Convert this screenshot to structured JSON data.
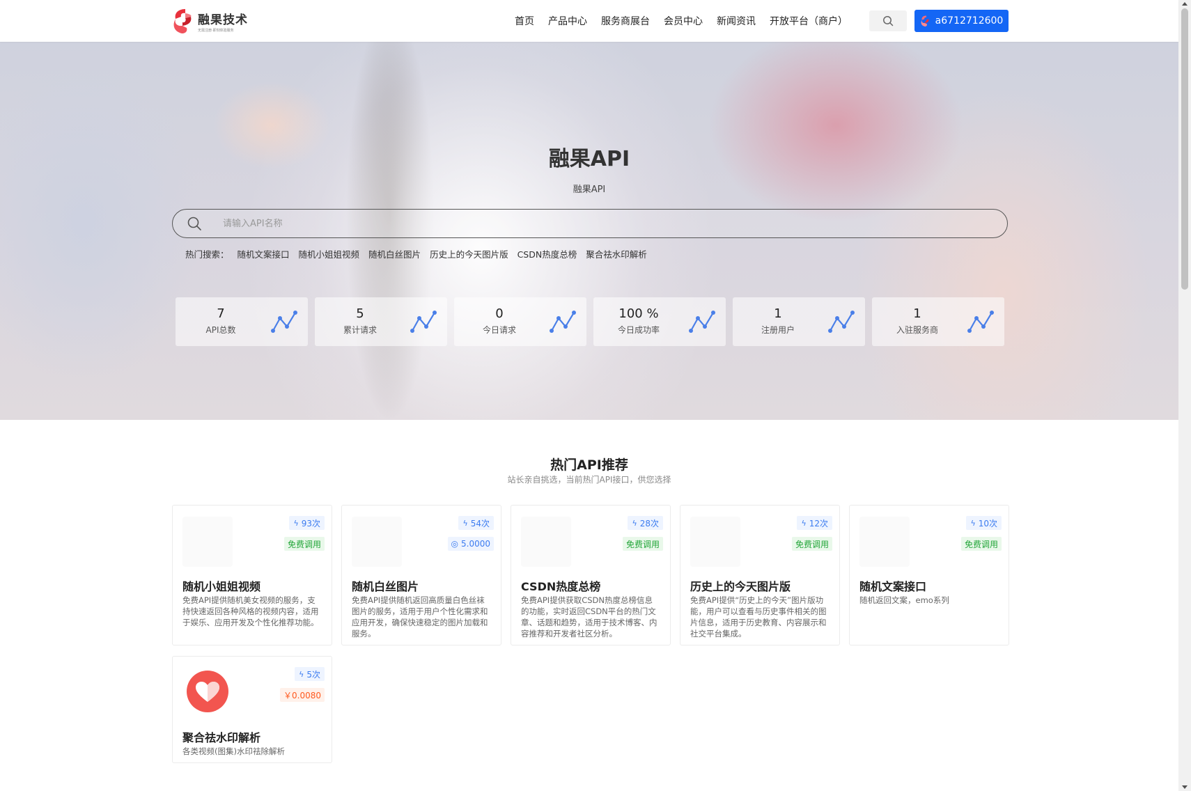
{
  "header": {
    "logo_text": "融果技术",
    "logo_sub": "无需注册·即刻体验服务",
    "nav": [
      "首页",
      "产品中心",
      "服务商展台",
      "会员中心",
      "新闻资讯",
      "开放平台（商户）"
    ],
    "user_label": "a6712712600"
  },
  "hero": {
    "title": "融果API",
    "subtitle": "融果API",
    "search_placeholder": "请输入API名称",
    "hot_label": "热门搜索：",
    "hot_links": [
      "随机文案接口",
      "随机小姐姐视频",
      "随机白丝图片",
      "历史上的今天图片版",
      "CSDN热度总榜",
      "聚合祛水印解析"
    ]
  },
  "stats": [
    {
      "value": "7",
      "label": "API总数"
    },
    {
      "value": "5",
      "label": "累计请求"
    },
    {
      "value": "0",
      "label": "今日请求"
    },
    {
      "value": "100 %",
      "label": "今日成功率"
    },
    {
      "value": "1",
      "label": "注册用户"
    },
    {
      "value": "1",
      "label": "入驻服务商"
    }
  ],
  "section": {
    "title": "热门API推荐",
    "subtitle": "站长亲自挑选，当前热门API接口，供您选择"
  },
  "cards": [
    {
      "count": "93次",
      "price": "免费调用",
      "price_type": "free",
      "title": "随机小姐姐视频",
      "desc": "免费API提供随机美女视频的服务，支持快速返回各种风格的视频内容，适用于娱乐、应用开发及个性化推荐功能。"
    },
    {
      "count": "54次",
      "price": "5.0000",
      "price_type": "points",
      "title": "随机白丝图片",
      "desc": "免费API提供随机返回高质量白色丝袜图片的服务，适用于用户个性化需求和应用开发，确保快速稳定的图片加载和服务。"
    },
    {
      "count": "28次",
      "price": "免费调用",
      "price_type": "free",
      "title": "CSDN热度总榜",
      "desc": "免费API提供获取CSDN热度总榜信息的功能，实时返回CSDN平台的热门文章、话题和趋势，适用于技术博客、内容推荐和开发者社区分析。"
    },
    {
      "count": "12次",
      "price": "免费调用",
      "price_type": "free",
      "title": "历史上的今天图片版",
      "desc": "免费API提供“历史上的今天”图片版功能，用户可以查看与历史事件相关的图片信息，适用于历史教育、内容展示和社交平台集成。"
    },
    {
      "count": "10次",
      "price": "免费调用",
      "price_type": "free",
      "title": "随机文案接口",
      "desc": "随机返回文案，emo系列"
    },
    {
      "count": "5次",
      "price": "￥0.0080",
      "price_type": "paid",
      "title": "聚合祛水印解析",
      "desc": "各类视频(图集)水印祛除解析"
    }
  ],
  "colors": {
    "accent": "#1466f5",
    "free": "#22a538",
    "paid": "#ff5a1f",
    "logo_red": "#e8313c"
  }
}
